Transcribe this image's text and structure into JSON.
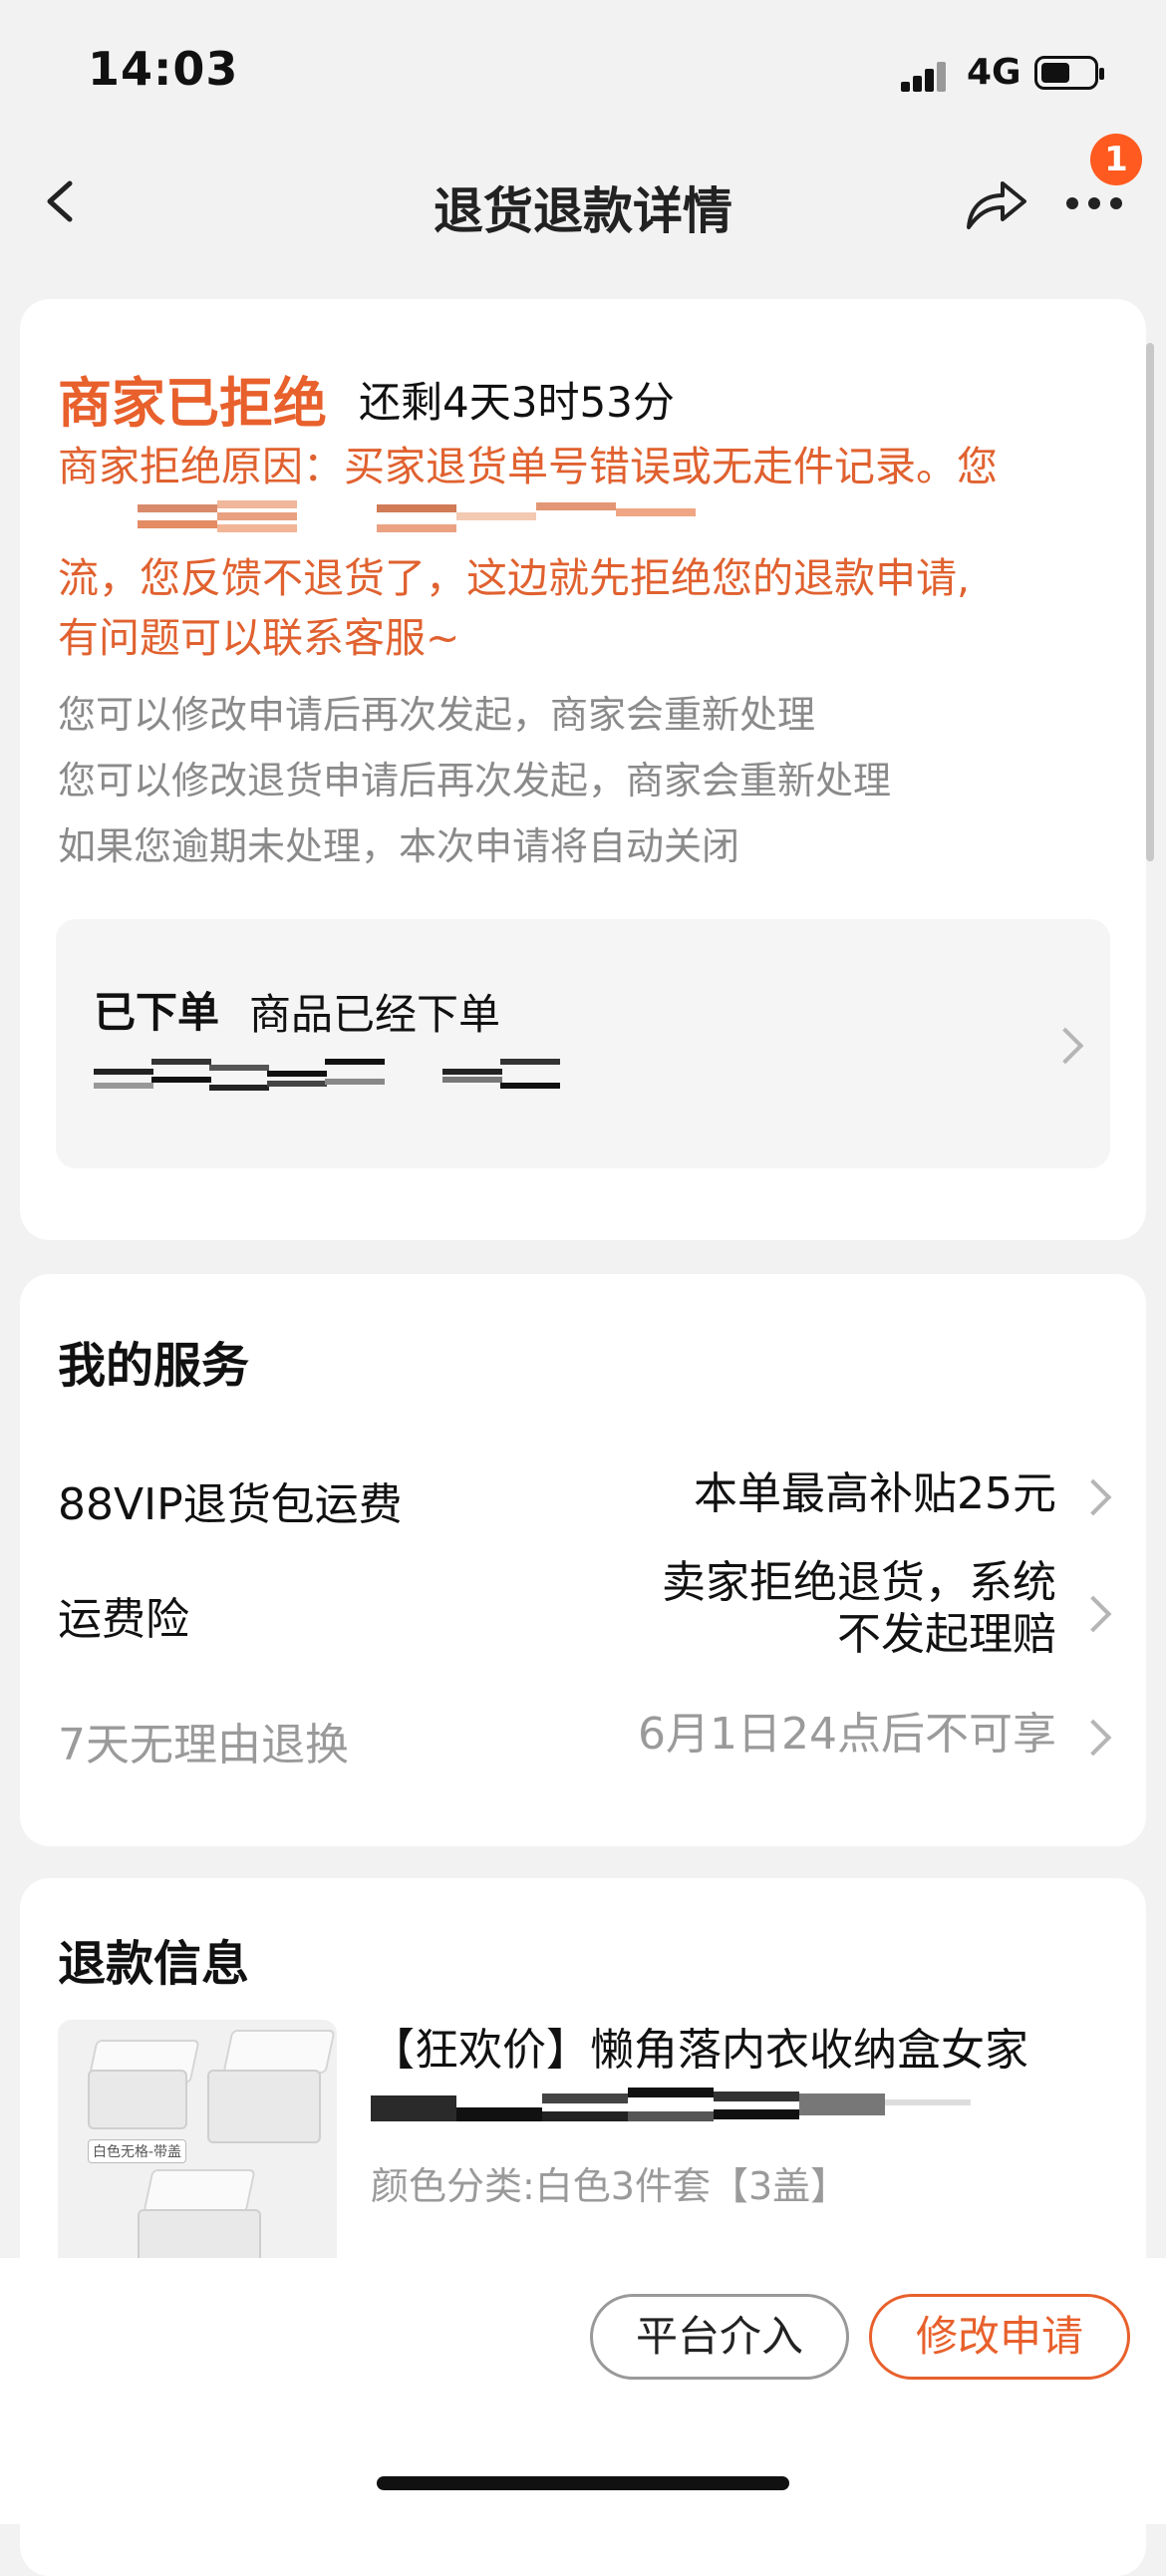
{
  "status_bar": {
    "time": "14:03",
    "network": "4G",
    "icons": [
      "signal-icon",
      "battery-icon"
    ]
  },
  "nav": {
    "title": "退货退款详情",
    "badge_count": "1",
    "icons": [
      "back-icon",
      "share-icon",
      "more-icon"
    ]
  },
  "refund_status": {
    "title": "商家已拒绝",
    "countdown": "还剩4天3时53分",
    "reason_line1": "商家拒绝原因：买家退货单号错误或无走件记录。您",
    "reason_line2": "流，您反馈不退货了，这边就先拒绝您的退款申请,",
    "reason_line3": "有问题可以联系客服~",
    "tips": [
      "您可以修改申请后再次发起，商家会重新处理",
      "您可以修改退货申请后再次发起，商家会重新处理",
      "如果您逾期未处理，本次申请将自动关闭"
    ],
    "accent_color": "#e8602c"
  },
  "order_status": {
    "title": "已下单",
    "desc": "商品已经下单"
  },
  "services": {
    "title": "我的服务",
    "items": [
      {
        "label": "88VIP退货包运费",
        "value": "本单最高补贴25元",
        "muted": false
      },
      {
        "label": "运费险",
        "value_line1": "卖家拒绝退货，系统",
        "value_line2": "不发起理赔",
        "muted": false
      },
      {
        "label": "7天无理由退换",
        "value": "6月1日24点后不可享",
        "muted": true
      }
    ]
  },
  "refund_info": {
    "title": "退款信息",
    "product_title": "【狂欢价】懒角落内衣收纳盒女家",
    "product_spec": "颜色分类:白色3件套【3盖】",
    "image_label": "白色无格-带盖"
  },
  "actions": {
    "platform_label": "平台介入",
    "modify_label": "修改申请"
  }
}
